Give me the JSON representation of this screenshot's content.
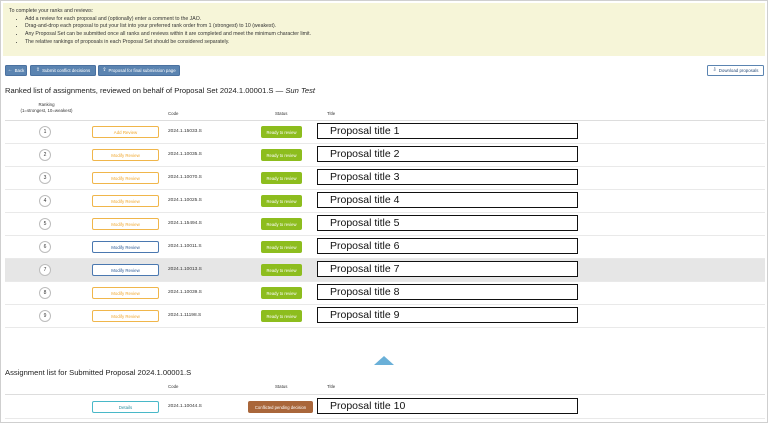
{
  "instructions": {
    "heading": "To complete your ranks and reviews:",
    "items": [
      "Add a review for each proposal and (optionally) enter a comment to the JAO.",
      "Drag-and-drop each proposal to put your list into your preferred rank order from 1 (strongest) to 10 (weakest).",
      "Any Proposal Set can be submitted once all ranks and reviews within it are completed and meet the minimum character limit.",
      "The relative rankings of proposals in each Proposal Set should be considered separately."
    ]
  },
  "toolbar": {
    "back_label": "Back",
    "conflict_label": "Submit conflict decisions",
    "final_label": "Proposal for final submission page",
    "download_label": "Download proposals"
  },
  "ranked": {
    "title_prefix": "Ranked list of assignments, reviewed on behalf of Proposal Set 2024.1.00001.S",
    "dash": "—",
    "reviewer": "Sun Test",
    "headers": {
      "ranking": "Ranking",
      "ranking_sub": "(1=strongest, 10=weakest)",
      "code": "Code",
      "status": "Status",
      "title": "Title"
    },
    "rows": [
      {
        "rank": "1",
        "review": "Add Review",
        "code": "2024.1.15033.S",
        "status": "Ready to review",
        "title": "Proposal title 1"
      },
      {
        "rank": "2",
        "review": "Modify Review",
        "code": "2024.1.10035.S",
        "status": "Ready to review",
        "title": "Proposal title 2"
      },
      {
        "rank": "3",
        "review": "Modify Review",
        "code": "2024.1.10070.S",
        "status": "Ready to review",
        "title": "Proposal title 3"
      },
      {
        "rank": "4",
        "review": "Modify Review",
        "code": "2024.1.10025.S",
        "status": "Ready to review",
        "title": "Proposal title 4"
      },
      {
        "rank": "5",
        "review": "Modify Review",
        "code": "2024.1.15494.S",
        "status": "Ready to review",
        "title": "Proposal title 5"
      },
      {
        "rank": "6",
        "review": "Modify Review",
        "code": "2024.1.10011.S",
        "status": "Ready to review",
        "title": "Proposal title 6"
      },
      {
        "rank": "7",
        "review": "Modify Review",
        "code": "2024.1.10013.S",
        "status": "Ready to review",
        "title": "Proposal title 7"
      },
      {
        "rank": "8",
        "review": "Modify Review",
        "code": "2024.1.10039.S",
        "status": "Ready to review",
        "title": "Proposal title 8"
      },
      {
        "rank": "9",
        "review": "Modify Review",
        "code": "2024.1.11198.S",
        "status": "Ready to review",
        "title": "Proposal title 9"
      }
    ]
  },
  "assignment": {
    "title": "Assignment list for Submitted Proposal 2024.1.00001.S",
    "headers": {
      "code": "Code",
      "status": "Status",
      "title": "Title"
    },
    "row": {
      "details": "Details",
      "code": "2024.1.10044.S",
      "status": "Conflicted pending decision",
      "title": "Proposal title 10"
    }
  },
  "colors": {
    "ready": "#8dbd1e",
    "conflicted": "#a9663a",
    "primary": "#5b84b1",
    "orange_outline": "#f0b64b",
    "blue_outline": "#4a78b0",
    "teal_outline": "#49b8c8"
  }
}
